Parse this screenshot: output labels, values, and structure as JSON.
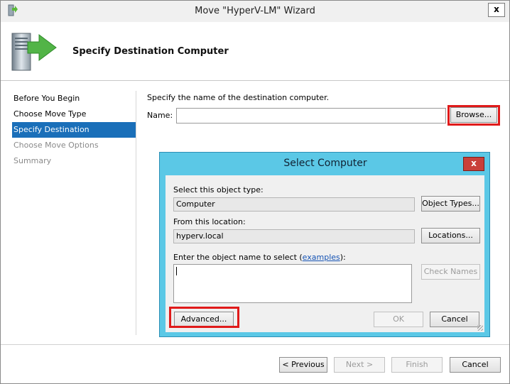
{
  "window": {
    "title": "Move \"HyperV-LM\" Wizard",
    "close_label": "x"
  },
  "header": {
    "page_title": "Specify Destination Computer"
  },
  "steps": [
    {
      "label": "Before You Begin"
    },
    {
      "label": "Choose Move Type"
    },
    {
      "label": "Specify Destination"
    },
    {
      "label": "Choose Move Options"
    },
    {
      "label": "Summary"
    }
  ],
  "main": {
    "instruction": "Specify the name of the destination computer.",
    "name_label": "Name:",
    "name_value": "",
    "browse_label": "Browse..."
  },
  "dialog": {
    "title": "Select Computer",
    "close_label": "x",
    "object_type_label": "Select this object type:",
    "object_type_value": "Computer",
    "object_types_button": "Object Types...",
    "location_label": "From this location:",
    "location_value": "hyperv.local",
    "locations_button": "Locations...",
    "enter_label_prefix": "Enter the object name to select (",
    "examples_link": "examples",
    "enter_label_suffix": "):",
    "names_value": "",
    "check_names_button": "Check Names",
    "advanced_button": "Advanced...",
    "ok_button": "OK",
    "cancel_button": "Cancel"
  },
  "footer": {
    "previous_button": "< Previous",
    "next_button": "Next >",
    "finish_button": "Finish",
    "cancel_button": "Cancel"
  },
  "colors": {
    "accent": "#1a6fb9",
    "highlight": "#e01a1a",
    "dialog_frame": "#5bc8e6"
  }
}
